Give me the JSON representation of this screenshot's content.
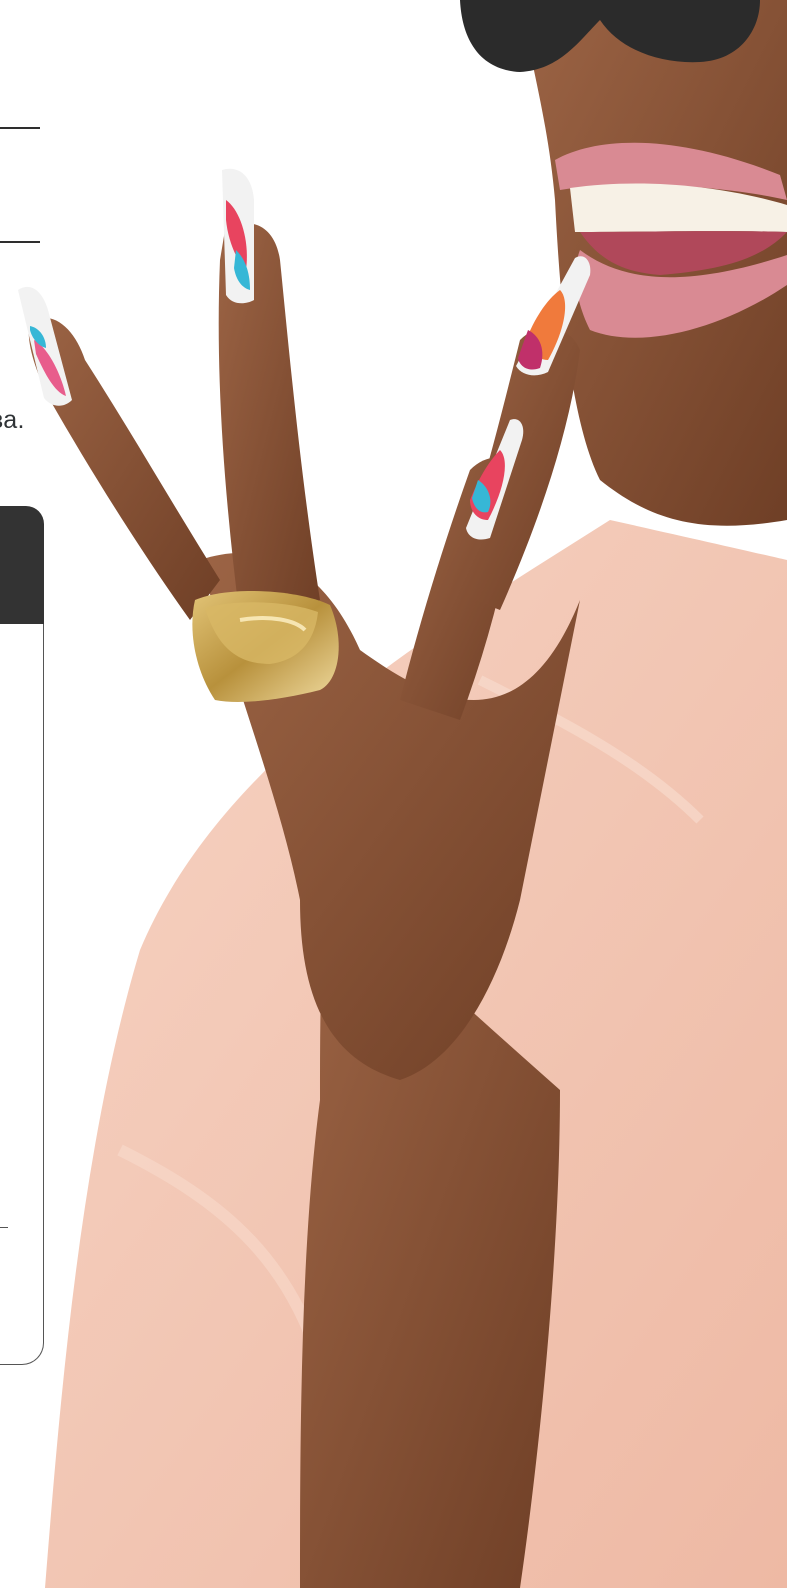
{
  "page": {
    "clipped_text": "ва."
  },
  "theme": {
    "text": "#2f3336",
    "panel_header": "#333333",
    "panel_border": "#555555",
    "blouse": "#f2c4b0",
    "skin": "#8a5436",
    "lips": "#d98a93",
    "ring": "#c9a34a",
    "sunglasses": "#2b2b2b"
  },
  "icons": [
    "photo-model-hand-ring"
  ]
}
